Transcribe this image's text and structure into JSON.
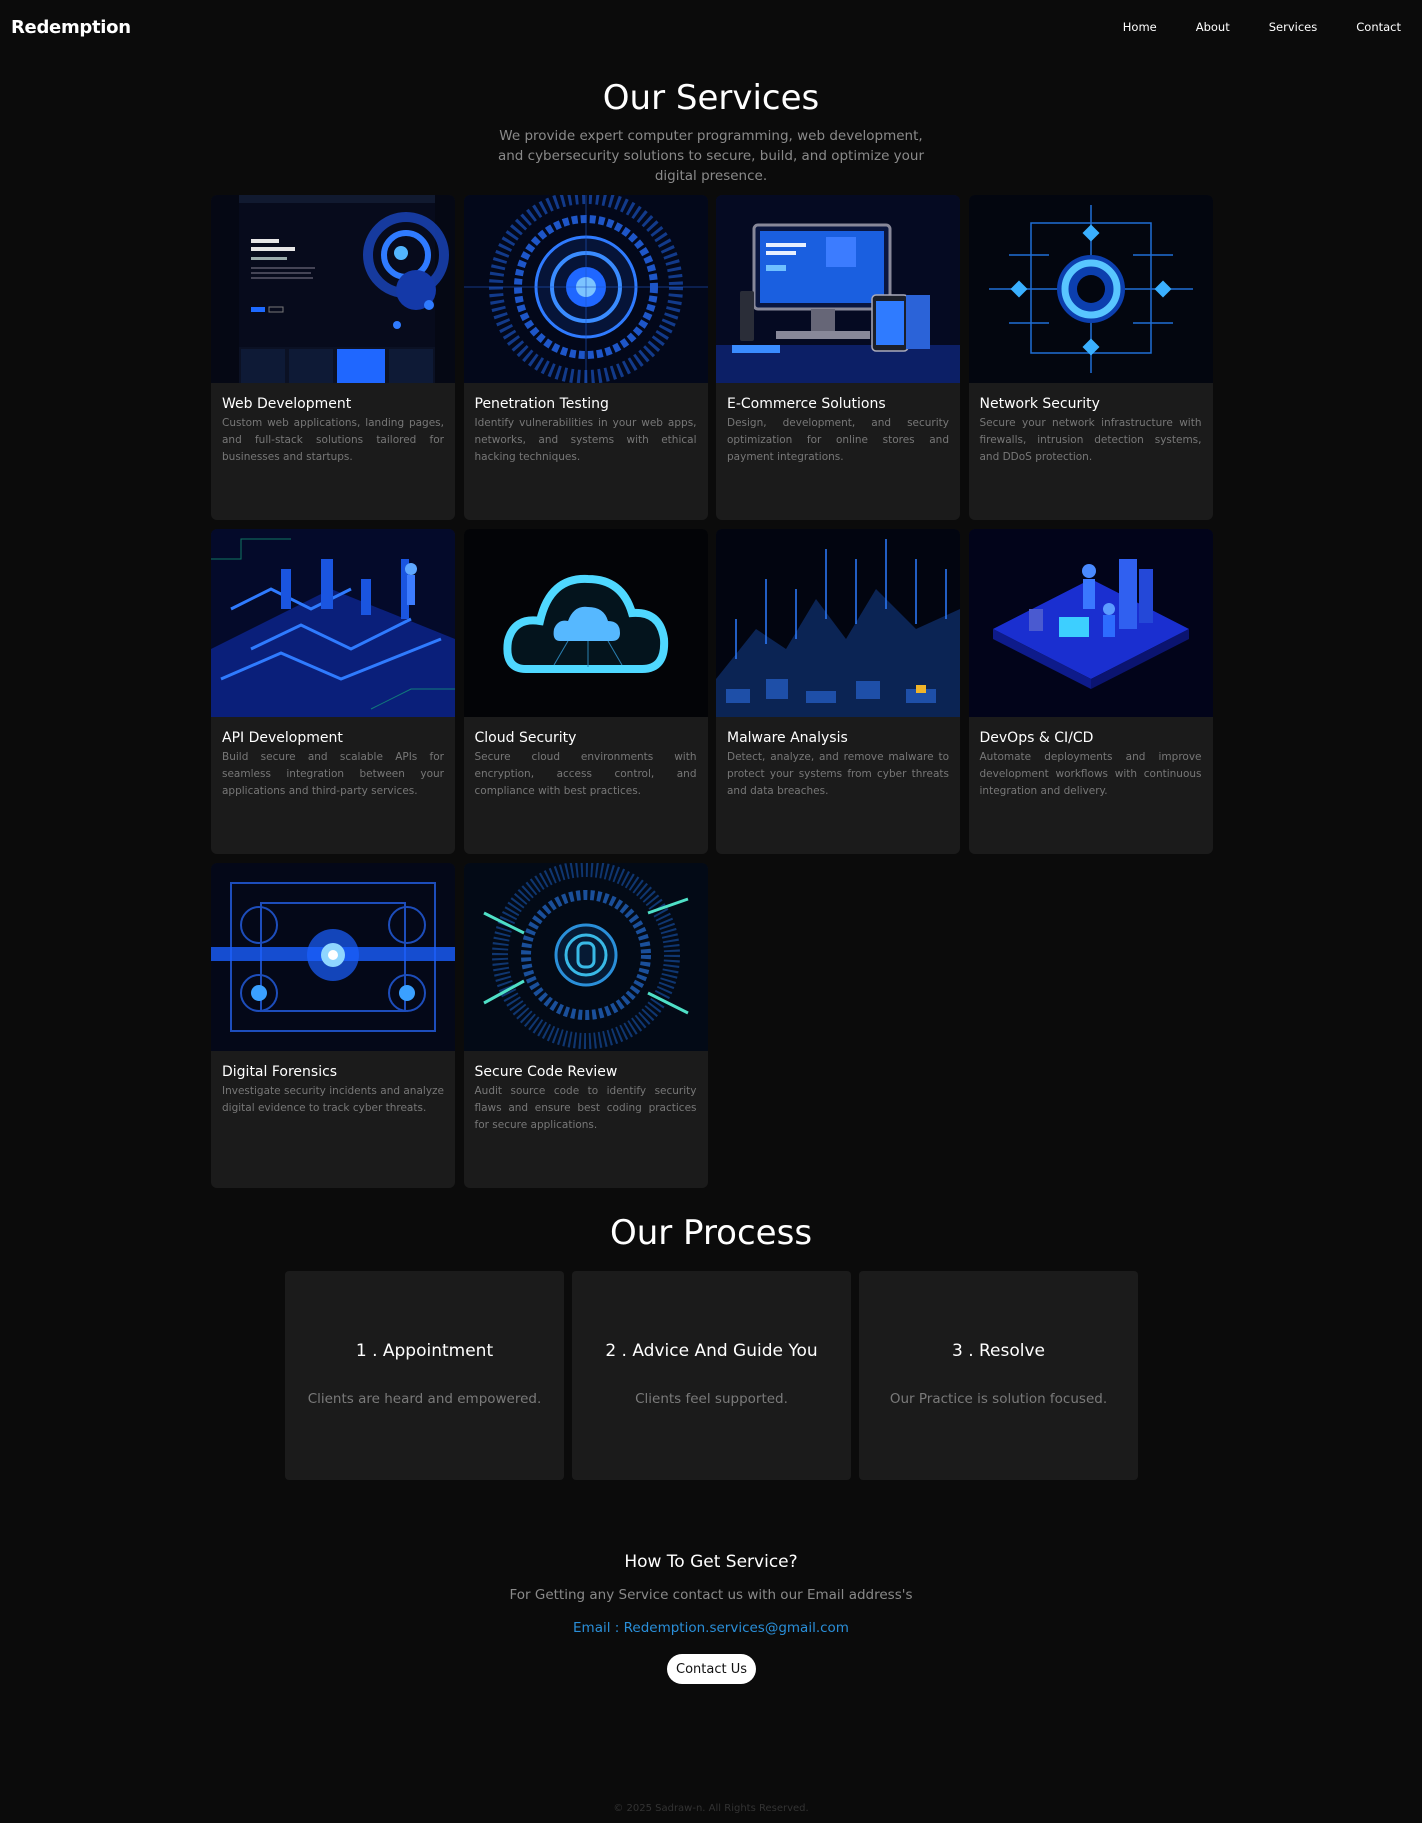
{
  "nav": {
    "logo": "Redemption",
    "links": [
      "Home",
      "About",
      "Services",
      "Contact"
    ]
  },
  "services": {
    "title": "Our Services",
    "subtitle": "We provide expert computer programming, web development, and cybersecurity solutions to secure, build, and optimize your digital presence.",
    "cards": [
      {
        "title": "Web Development",
        "desc": "Custom web applications, landing pages, and full-stack solutions tailored for businesses and startups.",
        "icon": "website-mockup-image"
      },
      {
        "title": "Penetration Testing",
        "desc": "Identify vulnerabilities in your web apps, networks, and systems with ethical hacking techniques.",
        "icon": "radial-target-image"
      },
      {
        "title": "E-Commerce Solutions",
        "desc": "Design, development, and security optimization for online stores and payment integrations.",
        "icon": "devices-image"
      },
      {
        "title": "Network Security",
        "desc": "Secure your network infrastructure with firewalls, intrusion detection systems, and DDoS protection.",
        "icon": "network-circuit-image"
      },
      {
        "title": "API Development",
        "desc": "Build secure and scalable APIs for seamless integration between your applications and third-party services.",
        "icon": "circuit-city-image"
      },
      {
        "title": "Cloud Security",
        "desc": "Secure cloud environments with encryption, access control, and compliance with best practices.",
        "icon": "cloud-image"
      },
      {
        "title": "Malware Analysis",
        "desc": "Detect, analyze, and remove malware to protect your systems from cyber threats and data breaches.",
        "icon": "data-landscape-image"
      },
      {
        "title": "DevOps & CI/CD",
        "desc": "Automate deployments and improve development workflows with continuous integration and delivery.",
        "icon": "isometric-team-image"
      },
      {
        "title": "Digital Forensics",
        "desc": "Investigate security incidents and analyze digital evidence to track cyber threats.",
        "icon": "chip-core-image"
      },
      {
        "title": "Secure Code Review",
        "desc": "Audit source code to identify security flaws and ensure best coding practices for secure applications.",
        "icon": "code-lock-image"
      }
    ]
  },
  "process": {
    "title": "Our Process",
    "steps": [
      {
        "title": "1 . Appointment",
        "desc": "Clients are heard and empowered."
      },
      {
        "title": "2 . Advice And Guide You",
        "desc": "Clients feel supported."
      },
      {
        "title": "3 . Resolve",
        "desc": "Our Practice is solution focused."
      }
    ]
  },
  "contact": {
    "title": "How To Get Service?",
    "subtitle": "For Getting any Service contact us with our Email address's",
    "email": "Email : Redemption.services@gmail.com",
    "button": "Contact Us"
  },
  "footer": "© 2025 Sadraw-n. All Rights Reserved.",
  "colors": {
    "accent": "#2a8fd9",
    "background": "#0b0b0b",
    "card": "#1b1b1b"
  }
}
